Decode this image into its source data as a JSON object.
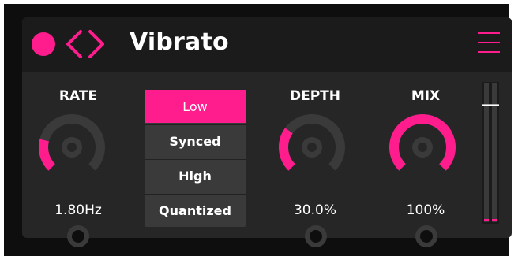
{
  "header": {
    "title": "Vibrato",
    "power_icon": "power-dot",
    "prev_icon": "chevron-left-icon",
    "next_icon": "chevron-right-icon",
    "menu_icon": "hamburger-menu-icon"
  },
  "controls": {
    "rate": {
      "label": "RATE",
      "value": "1.80Hz",
      "level": 0.22
    },
    "depth": {
      "label": "DEPTH",
      "value": "30.0%",
      "level": 0.3
    },
    "mix": {
      "label": "MIX",
      "value": "100%",
      "level": 1.0
    }
  },
  "modes": {
    "options": [
      "Low",
      "Synced",
      "High",
      "Quantized"
    ],
    "selected": "Low"
  },
  "meter": {
    "level": 0.85
  },
  "colors": {
    "accent": "#ff1d8e",
    "background": "#262626",
    "header": "#1b1b1b",
    "track": "#3a3a3a"
  }
}
